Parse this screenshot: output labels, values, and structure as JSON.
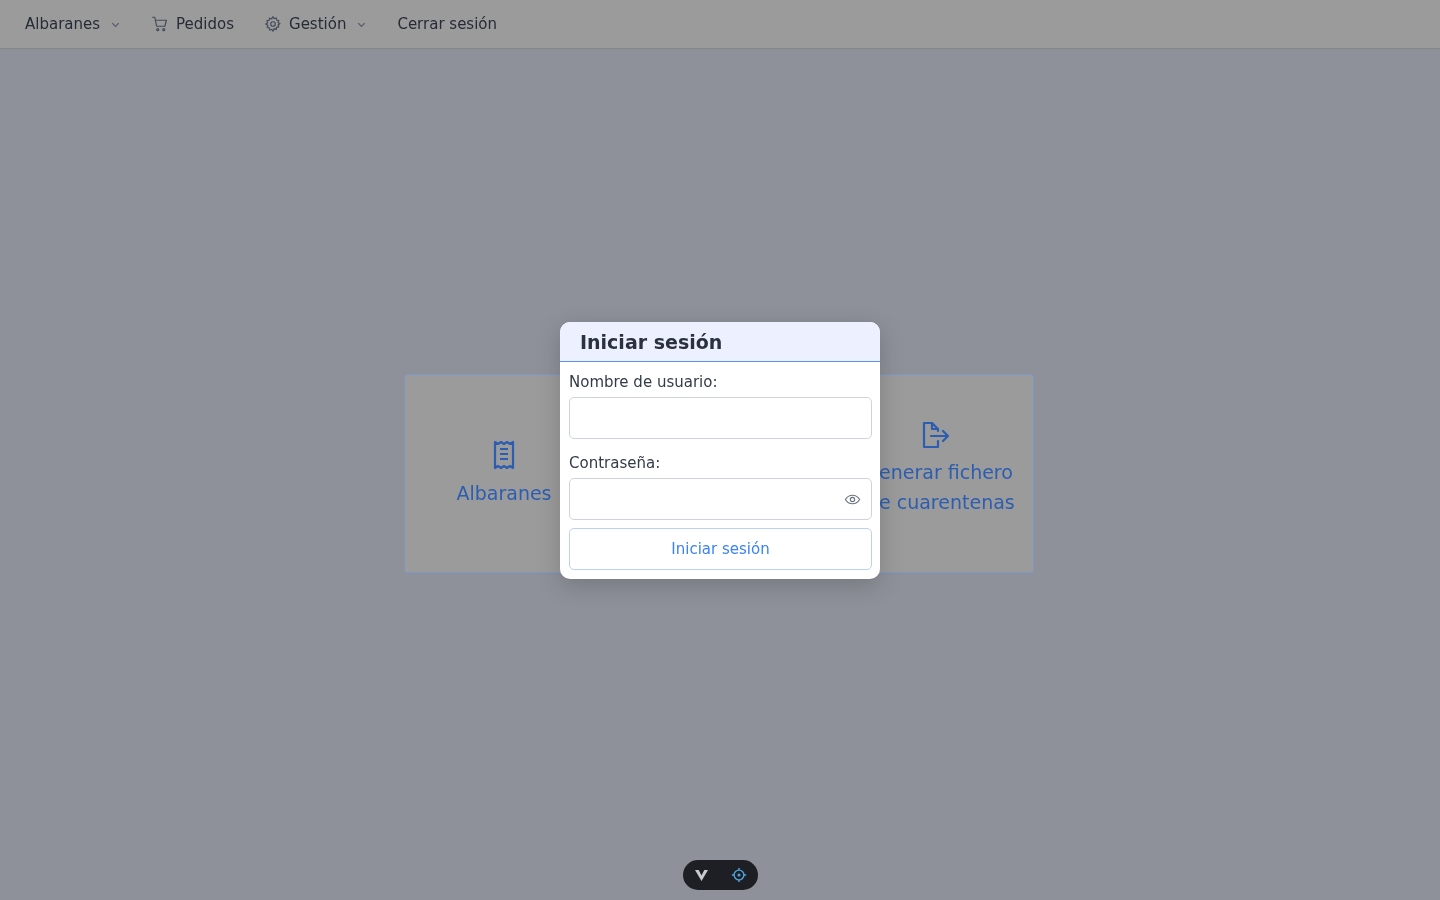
{
  "navbar": {
    "items": [
      {
        "label": "Albaranes",
        "dropdown": true
      },
      {
        "label": "Pedidos",
        "dropdown": false
      },
      {
        "label": "Gestión",
        "dropdown": true
      },
      {
        "label": "Cerrar sesión",
        "dropdown": false
      }
    ]
  },
  "cards": [
    {
      "lines": [
        "Albaranes"
      ]
    },
    {
      "lines": [
        "enerar fichero",
        "e cuarentenas"
      ]
    }
  ],
  "login_dialog": {
    "title": "Iniciar sesión",
    "fields": [
      {
        "label": "Nombre de usuario:",
        "kind": "text"
      },
      {
        "label": "Contraseña:",
        "kind": "password"
      }
    ],
    "submit": "Iniciar sesión"
  }
}
